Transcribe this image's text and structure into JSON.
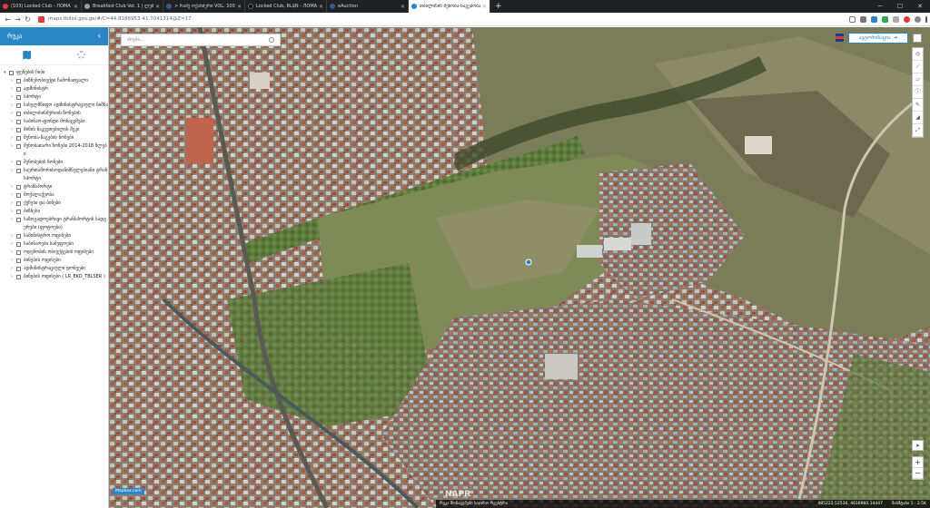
{
  "browser": {
    "tabs": [
      {
        "title": "(103) Locked Club - ЛОМА",
        "color": "#e53935",
        "active": false
      },
      {
        "title": "Breakfast Club Vol. 1 | ლუშ",
        "color": "#999999",
        "active": false
      },
      {
        "title": "> რამე ოქანძერი VOL. 100 -",
        "color": "#3b5998",
        "active": false
      },
      {
        "title": "Locked Club, RL$N - ЛОМА",
        "color": "#111111",
        "active": false
      },
      {
        "title": "eAuction",
        "color": "#3b5998",
        "active": false
      },
      {
        "title": "თბილისის შენობა-ნაგებობა",
        "color": "#2b86c5",
        "active": true
      }
    ],
    "new_tab": "+",
    "address": "maps.tbilisi.gov.ge/#/C=44.8186953-41.7041314@Z=17"
  },
  "sidebar": {
    "title": "რუკა",
    "layers": [
      {
        "label": "ფენების ჩიპი",
        "level": 0
      },
      {
        "label": "ბიზნესობიექტი ჩამონათვალი",
        "level": 1
      },
      {
        "label": "ადმინისტრ",
        "level": 1
      },
      {
        "label": "სპორტი",
        "level": 1
      },
      {
        "label": "სახელმწიფო ადმინისტრაციული ნიშნა",
        "level": 1
      },
      {
        "label": "თბილისისმერიის ზონების",
        "level": 1
      },
      {
        "label": "საბინაო-ფონდი მონაცემები",
        "level": 1
      },
      {
        "label": "მიწის ნაკვეთებილის შეკი",
        "level": 1
      },
      {
        "label": "შენობა-ნაგების ზონები",
        "level": 1
      },
      {
        "label": "შენობათარი ზონები 2014-2018 წლები",
        "level": 1
      },
      {
        "label": "შენობების ზონები",
        "level": 1
      },
      {
        "label": "საერთაშორისოდანიშნულებიანი ტრანსპორტი",
        "level": 1
      },
      {
        "label": "ტრანსპორტი",
        "level": 1
      },
      {
        "label": "მოქალაქეობა",
        "level": 1
      },
      {
        "label": "ქუჩები და ბინები",
        "level": 1
      },
      {
        "label": "ბიზნესი",
        "level": 1
      },
      {
        "label": "საზოგადოებრივი ტრანსპორტის სადგურები (ფოტოები)",
        "level": 1
      },
      {
        "label": "სამინისტრო ოფისები",
        "level": 1
      },
      {
        "label": "საბინაოები სამეფოები",
        "level": 1
      },
      {
        "label": "ოდენობის ობიექტების ოფისები",
        "level": 1
      },
      {
        "label": "ბინების ოფისები",
        "level": 1
      },
      {
        "label": "ადმინისტრაციული დონეები",
        "level": 1
      },
      {
        "label": "ბინების ოფისები ( LR_EKO_TBLSER )",
        "level": 1
      }
    ]
  },
  "map": {
    "search_placeholder": "ძიება...",
    "login_label": "ავტორიზაცია",
    "attribution": "Mapbox.com",
    "watermark": "NAPR",
    "status_left": "რუკა მონაცემები საჯარო რეესტრი",
    "coords": "485222.52530, 4616960.14447",
    "scale": "მასშტაბი 1 : 2.5K",
    "colors": {
      "accent": "#2b86c5",
      "terrain": "#6b7a55"
    }
  }
}
